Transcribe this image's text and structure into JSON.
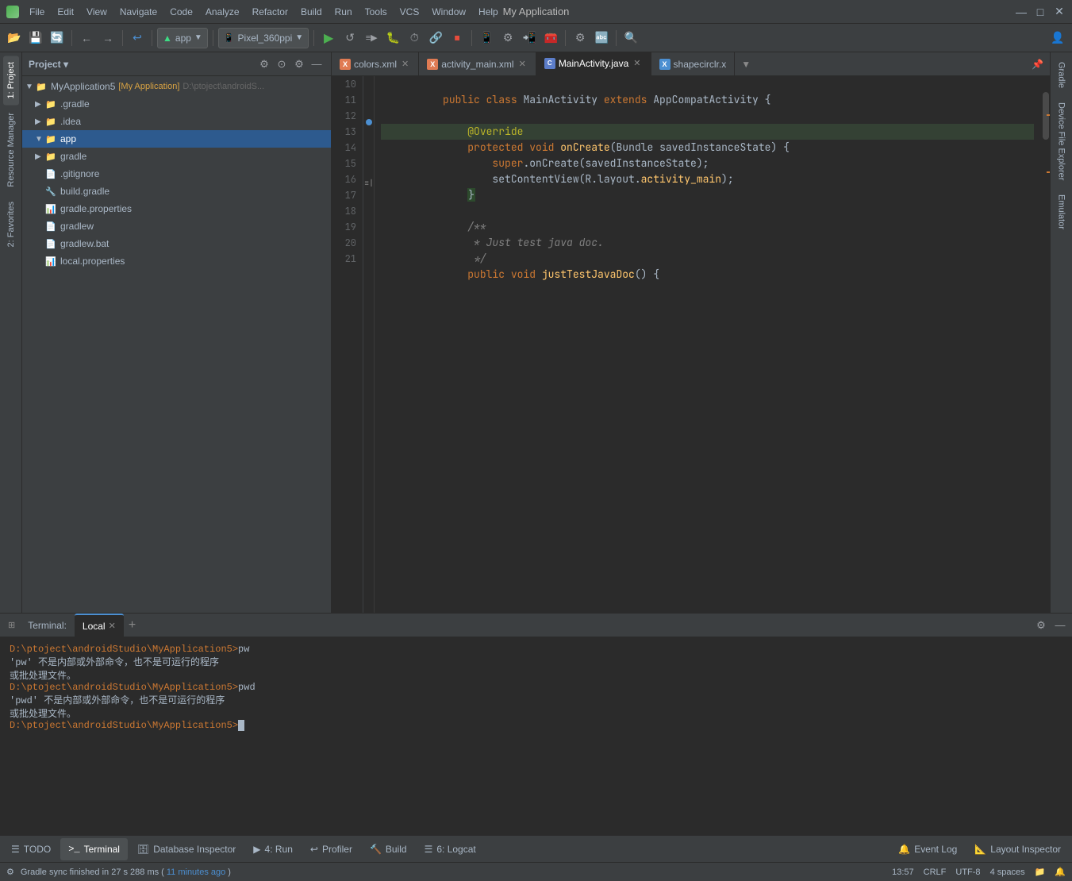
{
  "app": {
    "title": "My Application",
    "project_name": "MyApplication5"
  },
  "menu": {
    "items": [
      "File",
      "Edit",
      "View",
      "Navigate",
      "Code",
      "Analyze",
      "Refactor",
      "Build",
      "Run",
      "Tools",
      "VCS",
      "Window",
      "Help"
    ]
  },
  "toolbar": {
    "dropdown_app": "app",
    "dropdown_device": "Pixel_360ppi"
  },
  "project_panel": {
    "title": "Project",
    "root": {
      "name": "MyApplication5",
      "badge": "[My Application]",
      "path": "D:\\ptoject\\androidS..."
    },
    "items": [
      {
        "indent": 1,
        "type": "folder",
        "name": ".gradle",
        "expanded": false
      },
      {
        "indent": 1,
        "type": "folder",
        "name": ".idea",
        "expanded": false
      },
      {
        "indent": 1,
        "type": "folder",
        "name": "app",
        "expanded": true,
        "selected": true
      },
      {
        "indent": 1,
        "type": "folder",
        "name": "gradle",
        "expanded": false
      },
      {
        "indent": 1,
        "type": "file",
        "name": ".gitignore"
      },
      {
        "indent": 1,
        "type": "gradle",
        "name": "build.gradle"
      },
      {
        "indent": 1,
        "type": "properties",
        "name": "gradle.properties"
      },
      {
        "indent": 1,
        "type": "file",
        "name": "gradlew"
      },
      {
        "indent": 1,
        "type": "bat",
        "name": "gradlew.bat"
      },
      {
        "indent": 1,
        "type": "properties",
        "name": "local.properties"
      }
    ]
  },
  "editor": {
    "tabs": [
      {
        "id": "colors_xml",
        "label": "colors.xml",
        "type": "xml",
        "icon_text": "X",
        "active": false,
        "closable": true
      },
      {
        "id": "activity_main_xml",
        "label": "activity_main.xml",
        "type": "xml",
        "icon_text": "X",
        "active": false,
        "closable": true
      },
      {
        "id": "mainactivity_java",
        "label": "MainActivity.java",
        "type": "java",
        "icon_text": "C",
        "active": true,
        "closable": true
      },
      {
        "id": "shapecirclr",
        "label": "shapecirclr.x",
        "type": "shape",
        "icon_text": "X",
        "active": false,
        "closable": false
      }
    ],
    "lines": [
      {
        "num": 10,
        "content": "public class MainActivity extends AppCompatActivity {",
        "tokens": [
          {
            "text": "public ",
            "cls": "kw-orange"
          },
          {
            "text": "class ",
            "cls": "kw-orange"
          },
          {
            "text": "MainActivity ",
            "cls": "class-name"
          },
          {
            "text": "extends ",
            "cls": "kw-orange"
          },
          {
            "text": "AppCompatActivity ",
            "cls": "class-name"
          },
          {
            "text": "{",
            "cls": "kw-white"
          }
        ]
      },
      {
        "num": 11,
        "content": ""
      },
      {
        "num": 12,
        "content": "    @Override",
        "tokens": [
          {
            "text": "    ",
            "cls": ""
          },
          {
            "text": "@Override",
            "cls": "annotation"
          }
        ]
      },
      {
        "num": 13,
        "content": "    protected void onCreate(Bundle savedInstanceState) {",
        "highlight": true,
        "tokens": [
          {
            "text": "    ",
            "cls": ""
          },
          {
            "text": "protected ",
            "cls": "kw-orange"
          },
          {
            "text": "void ",
            "cls": "kw-orange"
          },
          {
            "text": "onCreate",
            "cls": "method-name"
          },
          {
            "text": "(",
            "cls": "kw-white"
          },
          {
            "text": "Bundle ",
            "cls": "class-name"
          },
          {
            "text": "savedInstanceState",
            "cls": "kw-white"
          },
          {
            "text": ") {",
            "cls": "kw-white"
          }
        ]
      },
      {
        "num": 14,
        "content": "        super.onCreate(savedInstanceState);",
        "tokens": [
          {
            "text": "        ",
            "cls": ""
          },
          {
            "text": "super",
            "cls": "kw-orange"
          },
          {
            "text": ".onCreate(savedInstanceState);",
            "cls": "kw-white"
          }
        ]
      },
      {
        "num": 15,
        "content": "        setContentView(R.layout.activity_main);",
        "tokens": [
          {
            "text": "        ",
            "cls": ""
          },
          {
            "text": "setContentView(R.layout.",
            "cls": "kw-white"
          },
          {
            "text": "activity_main",
            "cls": "method-name"
          },
          {
            "text": ");",
            "cls": "kw-white"
          }
        ]
      },
      {
        "num": 16,
        "content": "    }",
        "bracket": true,
        "tokens": [
          {
            "text": "    ",
            "cls": ""
          },
          {
            "text": "}",
            "cls": "bracket-highlight"
          }
        ]
      },
      {
        "num": 17,
        "content": ""
      },
      {
        "num": 18,
        "content": "    /**",
        "tokens": [
          {
            "text": "    /**",
            "cls": "comment"
          }
        ]
      },
      {
        "num": 19,
        "content": "     * Just test java doc.",
        "tokens": [
          {
            "text": "     * Just test java doc.",
            "cls": "comment"
          }
        ]
      },
      {
        "num": 20,
        "content": "     */",
        "tokens": [
          {
            "text": "     */",
            "cls": "comment"
          }
        ]
      },
      {
        "num": 21,
        "content": "    public void justTestJavaDoc() {",
        "tokens": [
          {
            "text": "    ",
            "cls": ""
          },
          {
            "text": "public ",
            "cls": "kw-orange"
          },
          {
            "text": "void ",
            "cls": "kw-orange"
          },
          {
            "text": "justTestJavaDoc",
            "cls": "method-name"
          },
          {
            "text": "() {",
            "cls": "kw-white"
          }
        ]
      }
    ]
  },
  "terminal": {
    "tabs": [
      {
        "label": "Local",
        "active": true,
        "closable": true
      }
    ],
    "lines": [
      {
        "type": "path",
        "text": "D:\\ptoject\\androidStudio\\MyApplication5>",
        "cmd": "pw"
      },
      {
        "type": "error",
        "text": "'pw' 不是内部或外部命令，也不是可运行的程序\n或批处理文件。"
      },
      {
        "type": "blank"
      },
      {
        "type": "path",
        "text": "D:\\ptoject\\androidStudio\\MyApplication5>",
        "cmd": "pwd"
      },
      {
        "type": "error",
        "text": "'pwd' 不是内部或外部命令，也不是可运行的程序\n或批处理文件。"
      },
      {
        "type": "blank"
      },
      {
        "type": "prompt",
        "text": "D:\\ptoject\\androidStudio\\MyApplication5>"
      }
    ]
  },
  "bottom_toolbar": {
    "tabs": [
      {
        "id": "todo",
        "label": "TODO",
        "icon": "☰",
        "active": false
      },
      {
        "id": "terminal",
        "label": "Terminal",
        "icon": ">_",
        "active": true
      },
      {
        "id": "db_inspector",
        "label": "Database Inspector",
        "icon": "🗄",
        "active": false
      },
      {
        "id": "run",
        "label": "4: Run",
        "icon": "▶",
        "active": false
      },
      {
        "id": "profiler",
        "label": "Profiler",
        "icon": "↩",
        "active": false
      },
      {
        "id": "build",
        "label": "Build",
        "icon": "🔨",
        "active": false
      },
      {
        "id": "logcat",
        "label": "6: Logcat",
        "icon": "☰",
        "active": false
      }
    ],
    "right_tabs": [
      {
        "id": "event_log",
        "label": "Event Log",
        "icon": "🔔"
      },
      {
        "id": "layout_inspector",
        "label": "Layout Inspector",
        "icon": "📐"
      }
    ]
  },
  "status_bar": {
    "message": "Gradle sync finished in 27 s 288 ms",
    "time_ago": "11 minutes ago",
    "time": "13:57",
    "line_ending": "CRLF",
    "encoding": "UTF-8",
    "indent": "4 spaces"
  },
  "right_sidebar": {
    "tabs": [
      "Gradle",
      "Device File Explorer",
      "Emulator"
    ]
  },
  "left_sidebar": {
    "tabs": [
      "1: Project",
      "Resource Manager",
      "2: Favorites"
    ]
  }
}
